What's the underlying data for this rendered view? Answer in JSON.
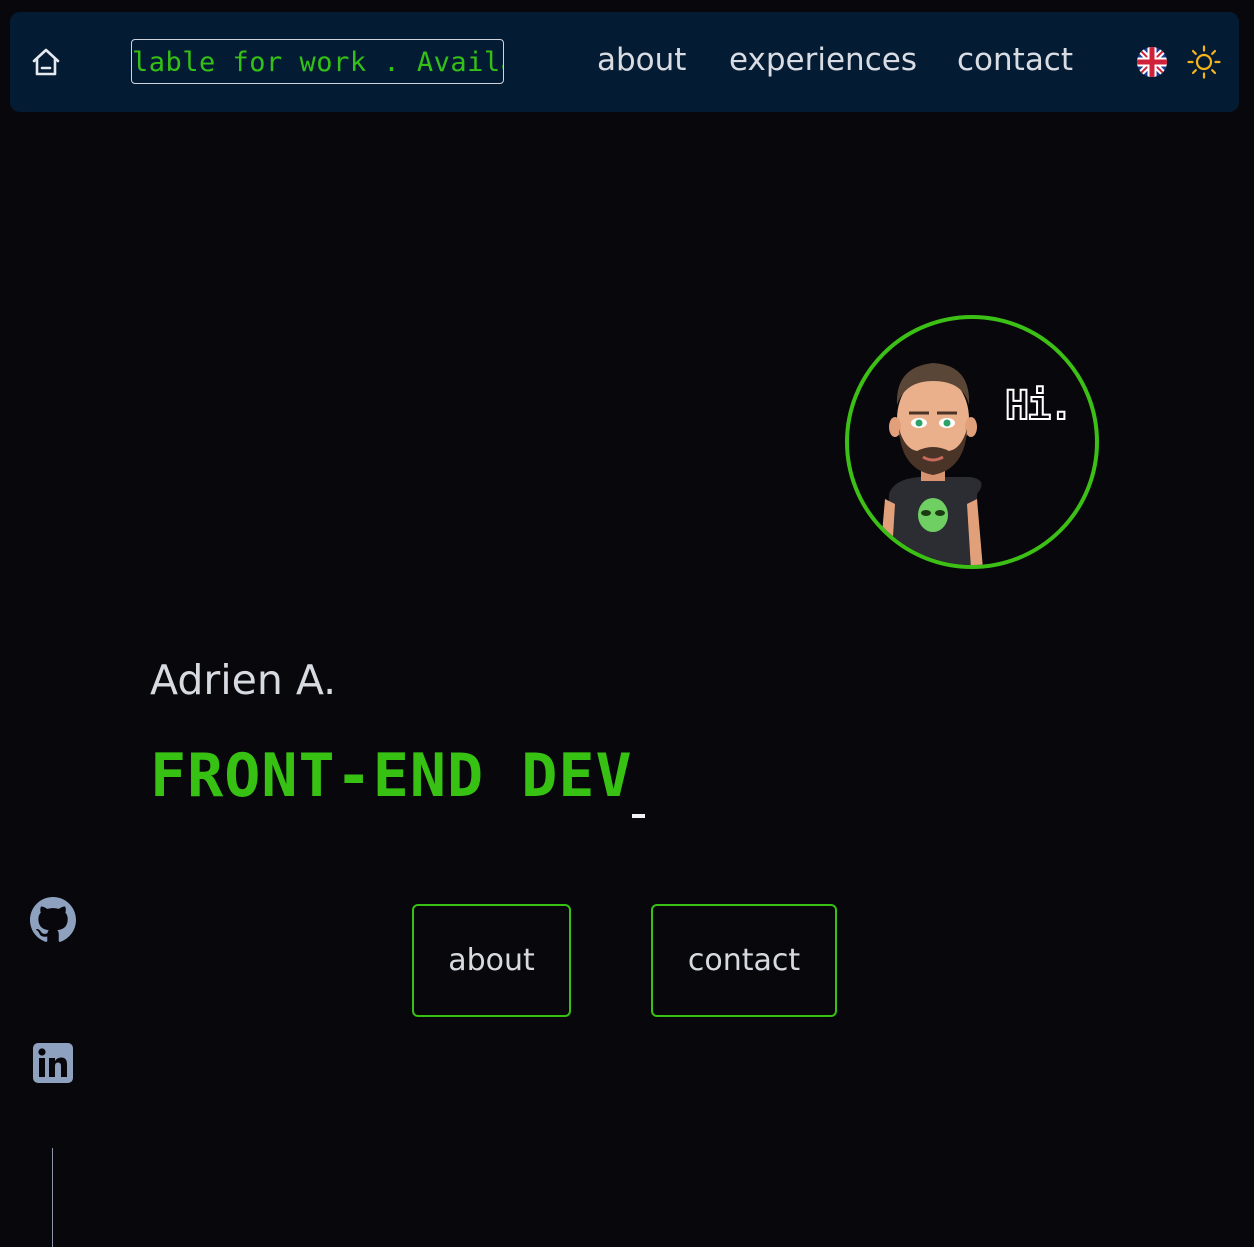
{
  "navbar": {
    "marquee_text": "lable for work . Available for work . Available",
    "links": {
      "about": "about",
      "experiences": "experiences",
      "contact": "contact"
    },
    "icons": {
      "home": "home-icon",
      "language": "uk-flag-icon",
      "theme": "sun-icon"
    }
  },
  "hero": {
    "avatar_greeting": "Hi.",
    "name": "Adrien A.",
    "role": "FRONT-END DEV",
    "buttons": {
      "about": "about",
      "contact": "contact"
    }
  },
  "social": {
    "icons": [
      "github-icon",
      "linkedin-icon"
    ]
  },
  "colors": {
    "background": "#08080c",
    "navbar": "#041b34",
    "accent_green": "#36c113",
    "text": "#d7dbe1",
    "sun": "#f4b41a"
  }
}
